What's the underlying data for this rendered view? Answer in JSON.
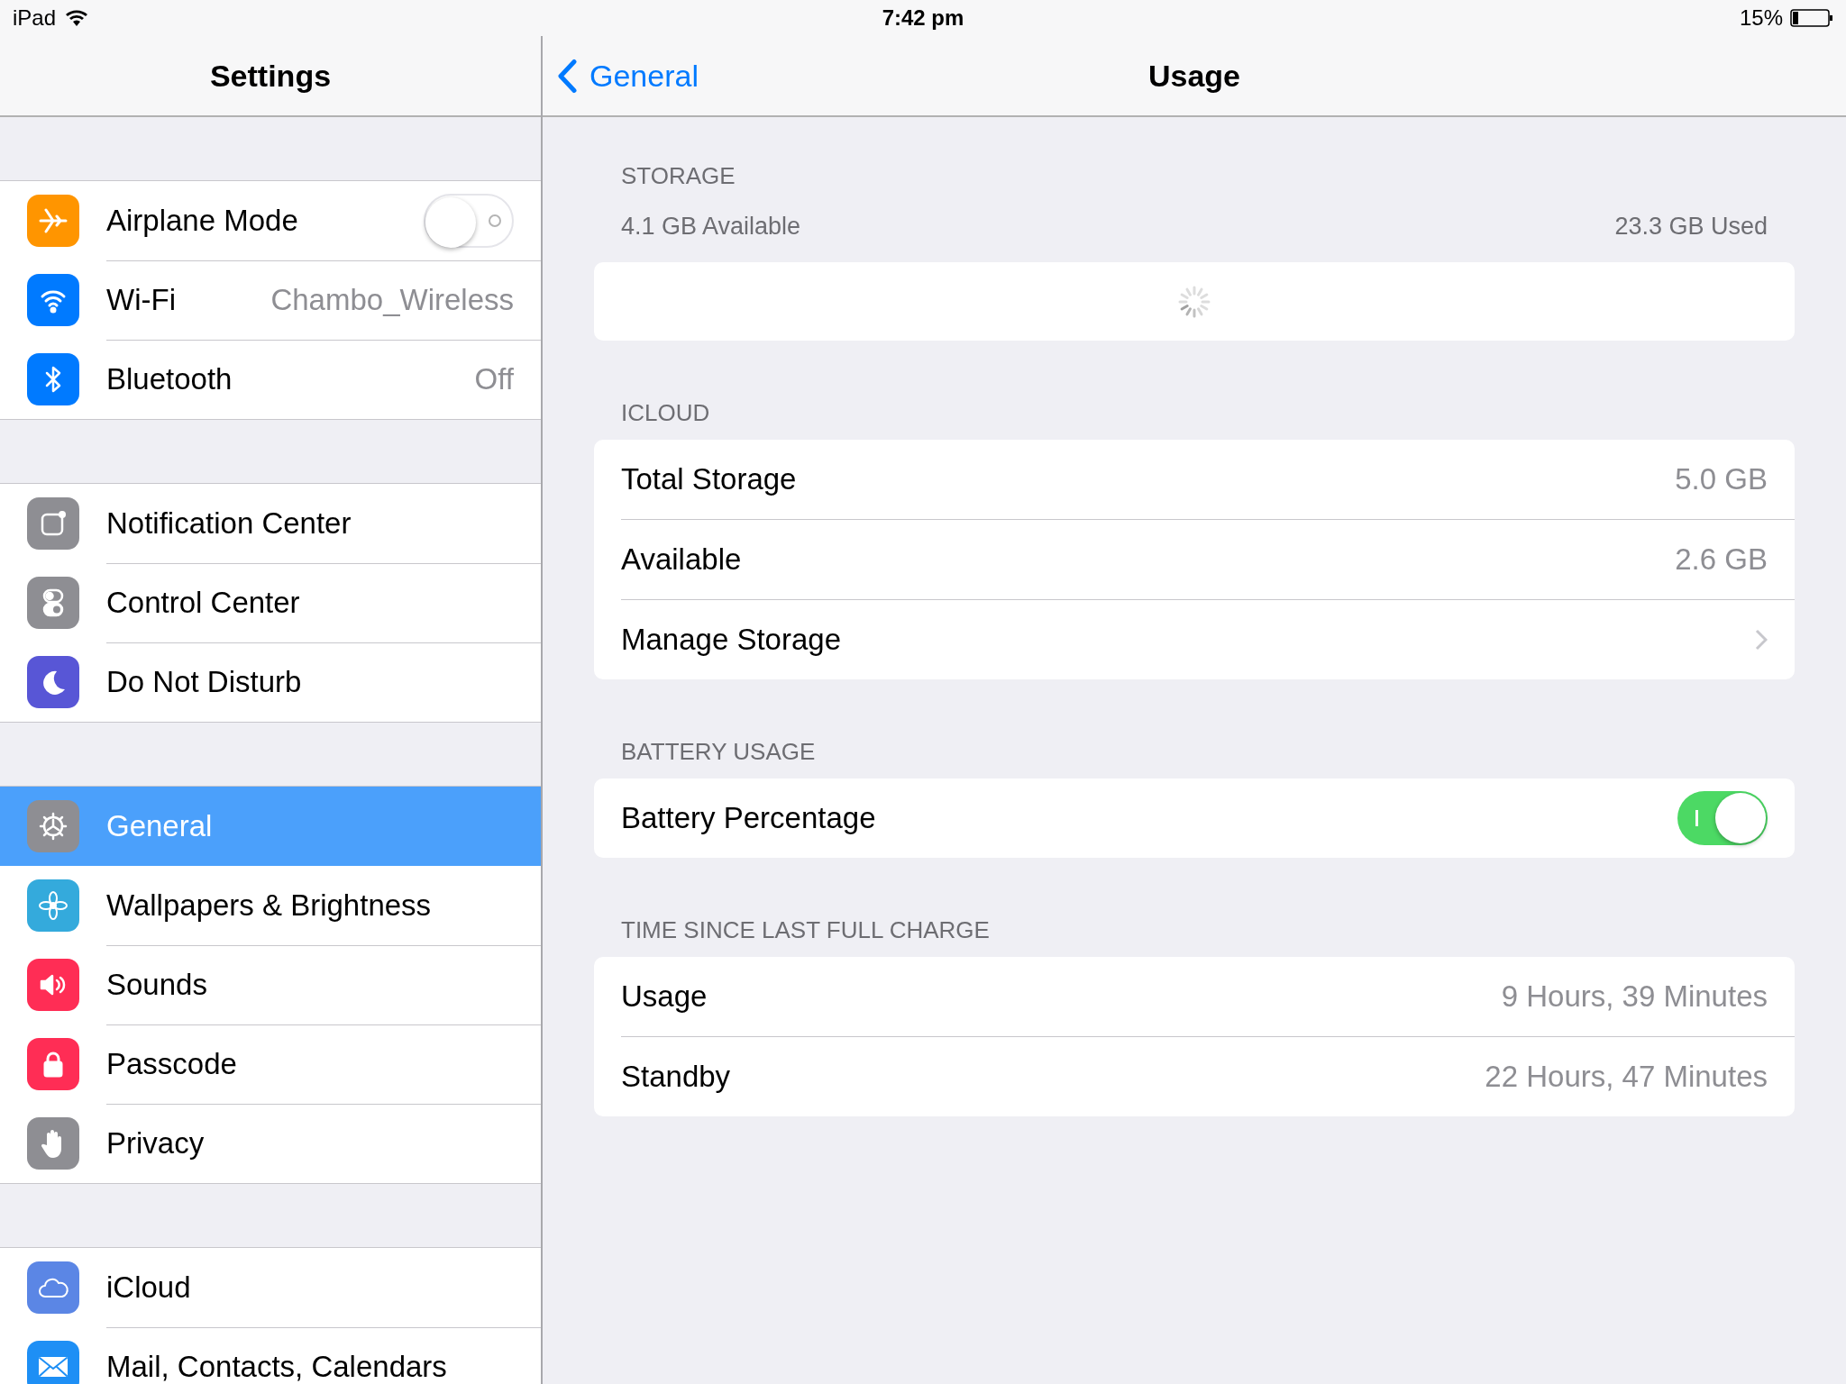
{
  "status_bar": {
    "device": "iPad",
    "time": "7:42 pm",
    "battery": "15%"
  },
  "sidebar": {
    "title": "Settings",
    "groups": [
      {
        "items": [
          {
            "label": "Airplane Mode",
            "kind": "toggle",
            "on": false,
            "selected": false,
            "color": "#ff9500"
          },
          {
            "label": "Wi-Fi",
            "kind": "value",
            "value": "Chambo_Wireless",
            "selected": false,
            "color": "#007aff"
          },
          {
            "label": "Bluetooth",
            "kind": "value",
            "value": "Off",
            "selected": false,
            "color": "#007aff"
          }
        ]
      },
      {
        "items": [
          {
            "label": "Notification Center",
            "kind": "plain",
            "selected": false,
            "color": "#8e8e93"
          },
          {
            "label": "Control Center",
            "kind": "plain",
            "selected": false,
            "color": "#8e8e93"
          },
          {
            "label": "Do Not Disturb",
            "kind": "plain",
            "selected": false,
            "color": "#5856d6"
          }
        ]
      },
      {
        "items": [
          {
            "label": "General",
            "kind": "plain",
            "selected": true,
            "color": "#8e8e93"
          },
          {
            "label": "Wallpapers & Brightness",
            "kind": "plain",
            "selected": false,
            "color": "#34aadc"
          },
          {
            "label": "Sounds",
            "kind": "plain",
            "selected": false,
            "color": "#ff2d55"
          },
          {
            "label": "Passcode",
            "kind": "plain",
            "selected": false,
            "color": "#ff2d55"
          },
          {
            "label": "Privacy",
            "kind": "plain",
            "selected": false,
            "color": "#8e8e93"
          }
        ]
      },
      {
        "items": [
          {
            "label": "iCloud",
            "kind": "plain",
            "selected": false,
            "color": "#5b86e5"
          },
          {
            "label": "Mail, Contacts, Calendars",
            "kind": "plain",
            "selected": false,
            "color": "#1e8ff5"
          }
        ]
      }
    ]
  },
  "detail": {
    "back": "General",
    "title": "Usage",
    "sections": [
      {
        "header": "STORAGE",
        "kind": "storage",
        "available": "4.1 GB Available",
        "used": "23.3 GB Used"
      },
      {
        "header": "ICLOUD",
        "kind": "list",
        "rows": [
          {
            "label": "Total Storage",
            "kind": "value",
            "value": "5.0 GB"
          },
          {
            "label": "Available",
            "kind": "value",
            "value": "2.6 GB"
          },
          {
            "label": "Manage Storage",
            "kind": "link"
          }
        ]
      },
      {
        "header": "BATTERY USAGE",
        "kind": "list",
        "rows": [
          {
            "label": "Battery Percentage",
            "kind": "toggle",
            "on": true
          }
        ]
      },
      {
        "header": "TIME SINCE LAST FULL CHARGE",
        "kind": "list",
        "rows": [
          {
            "label": "Usage",
            "kind": "value",
            "value": "9 Hours, 39 Minutes"
          },
          {
            "label": "Standby",
            "kind": "value",
            "value": "22 Hours, 47 Minutes"
          }
        ]
      }
    ]
  }
}
